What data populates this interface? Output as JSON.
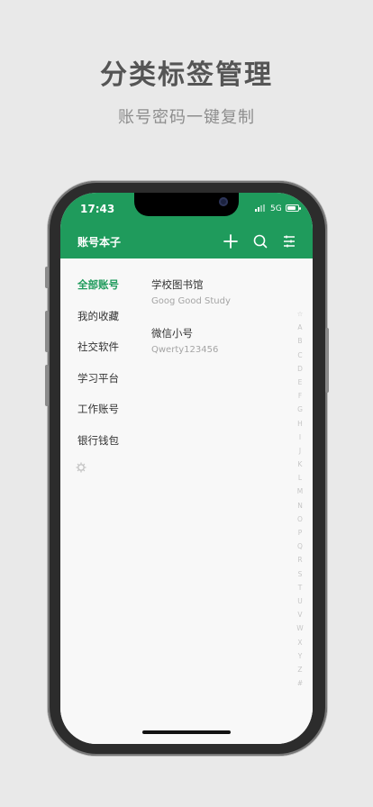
{
  "promo": {
    "headline": "分类标签管理",
    "subline": "账号密码一键复制"
  },
  "status": {
    "time": "17:43",
    "network": "5G"
  },
  "app": {
    "title": "账号本子",
    "accent": "#1f9b5c",
    "icons": [
      "plus-icon",
      "search-icon",
      "menu-icon"
    ]
  },
  "categories": [
    {
      "label": "全部账号",
      "active": true
    },
    {
      "label": "我的收藏"
    },
    {
      "label": "社交软件"
    },
    {
      "label": "学习平台"
    },
    {
      "label": "工作账号"
    },
    {
      "label": "银行钱包"
    }
  ],
  "accounts": [
    {
      "name": "学校图书馆",
      "sub": "Goog Good Study"
    },
    {
      "name": "微信小号",
      "sub": "Qwerty123456"
    }
  ],
  "alphabet_index": [
    "☆",
    "A",
    "B",
    "C",
    "D",
    "E",
    "F",
    "G",
    "H",
    "I",
    "J",
    "K",
    "L",
    "M",
    "N",
    "O",
    "P",
    "Q",
    "R",
    "S",
    "T",
    "U",
    "V",
    "W",
    "X",
    "Y",
    "Z",
    "#"
  ]
}
